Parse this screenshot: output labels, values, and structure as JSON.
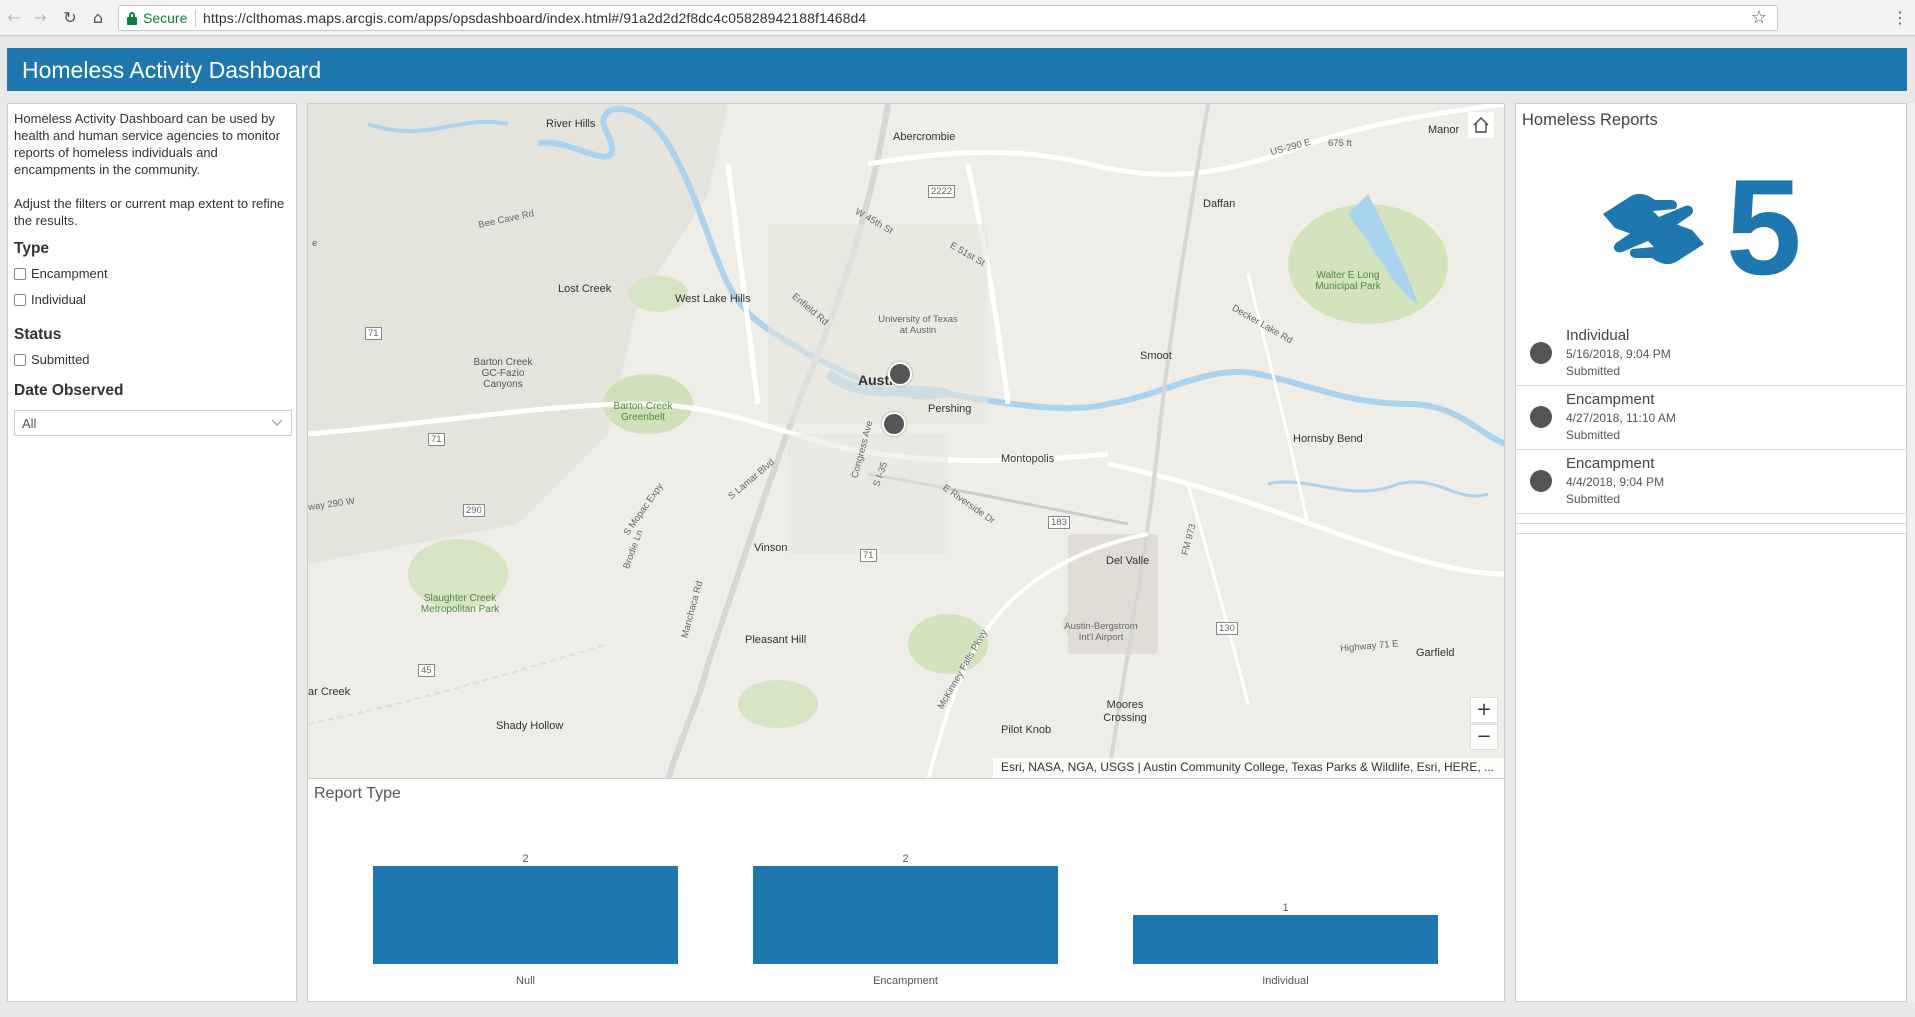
{
  "browser": {
    "secure_label": "Secure",
    "url": "https://clthomas.maps.arcgis.com/apps/opsdashboard/index.html#/91a2d2d2f8dc4c05828942188f1468d4"
  },
  "header": {
    "title": "Homeless Activity Dashboard"
  },
  "sidebar": {
    "description_1": "Homeless Activity Dashboard can be used by health and human service agencies to monitor reports of homeless individuals and encampments in the community.",
    "description_2": "Adjust the filters or current map extent to refine the results.",
    "type_heading": "Type",
    "type_options": [
      "Encampment",
      "Individual"
    ],
    "status_heading": "Status",
    "status_options": [
      "Submitted"
    ],
    "date_heading": "Date Observed",
    "date_value": "All"
  },
  "map": {
    "labels": {
      "river_hills": "River Hills",
      "abercrombie": "Abercrombie",
      "manor": "Manor",
      "daffan": "Daffan",
      "lost_creek": "Lost Creek",
      "west_lake_hills": "West Lake Hills",
      "ut_austin": "University of Texas at Austin",
      "austin": "Austin",
      "pershing": "Pershing",
      "smoot": "Smoot",
      "montopolis": "Montopolis",
      "hornsby_bend": "Hornsby Bend",
      "vinson": "Vinson",
      "del_valle": "Del Valle",
      "pleasant_hill": "Pleasant Hill",
      "garfield": "Garfield",
      "shady_hollow": "Shady Hollow",
      "moores_crossing": "Moores Crossing",
      "pilot_knob": "Pilot Knob",
      "creek": "ar Creek",
      "barton_gc": "Barton Creek GC-Fazio Canyons",
      "barton_greenbelt": "Barton Creek Greenbelt",
      "slaughter": "Slaughter Creek Metropolitan Park",
      "walter_long": "Walter E Long Municipal Park",
      "airport": "Austin-Bergstrom Int'l Airport",
      "bee_cave": "Bee Cave Rd",
      "enfield": "Enfield Rd",
      "w45": "W 45th St",
      "e51": "E 51st St",
      "us290e": "US-290 E",
      "hwy290w": "way 290 W",
      "highway71e": "Highway 71 E",
      "riverside": "E Riverside Dr",
      "s_lamar": "S Lamar Blvd",
      "s_mopac": "S Mopac Expy",
      "brodie": "Brodie Ln",
      "manchaca": "Manchaca Rd",
      "congress": "Congress Ave",
      "i35": "S I-35",
      "mckinney": "McKinney Falls Pkwy",
      "decker": "Decker Lake Rd",
      "fm973": "FM 973",
      "r71a": "71",
      "r71b": "71",
      "r71c": "71",
      "r183": "183",
      "r290": "290",
      "r45": "45",
      "r130": "130",
      "r2222": "2222",
      "ft675": "675 ft",
      "e": "e"
    },
    "attribution": "Esri, NASA, NGA, USGS | Austin Community College, Texas Parks & Wildlife, Esri, HERE, ...",
    "zoom_in": "+",
    "zoom_out": "−",
    "points": [
      {
        "lon_frac": 0.496,
        "lat_frac": 0.4
      },
      {
        "lon_frac": 0.491,
        "lat_frac": 0.475
      }
    ]
  },
  "chart_data": {
    "type": "bar",
    "title": "Report Type",
    "categories": [
      "Null",
      "Encampment",
      "Individual"
    ],
    "values": [
      2,
      2,
      1
    ],
    "ylim": [
      0,
      2
    ],
    "color": "#1f77b0"
  },
  "reports": {
    "title": "Homeless Reports",
    "count": "5",
    "accent_color": "#1f77b0",
    "icon": "helping-hands-icon",
    "items": [
      {
        "type": "Individual",
        "date": "5/16/2018, 9:04 PM",
        "status": "Submitted"
      },
      {
        "type": "Encampment",
        "date": "4/27/2018, 11:10 AM",
        "status": "Submitted"
      },
      {
        "type": "Encampment",
        "date": "4/4/2018, 9:04 PM",
        "status": "Submitted"
      }
    ]
  }
}
